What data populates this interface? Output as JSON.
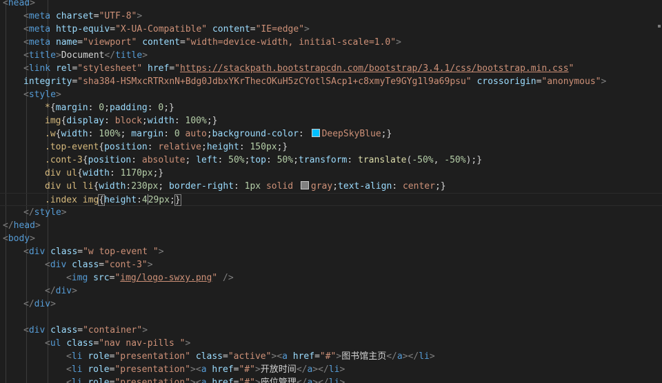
{
  "code": {
    "l1": [
      "<",
      "head",
      ">"
    ],
    "l2": [
      "<",
      "meta",
      "charset",
      "=",
      "\"UTF-8\"",
      ">"
    ],
    "l3": [
      "<",
      "meta",
      "http-equiv",
      "=",
      "\"X-UA-Compatible\"",
      "content",
      "=",
      "\"IE=edge\"",
      ">"
    ],
    "l4": [
      "<",
      "meta",
      "name",
      "=",
      "\"viewport\"",
      "content",
      "=",
      "\"width=device-width, initial-scale=1.0\"",
      ">"
    ],
    "l5": [
      "<",
      "title",
      ">",
      "Document",
      "</",
      "title",
      ">"
    ],
    "l6": [
      "<",
      "link",
      "rel",
      "=",
      "\"stylesheet\"",
      "href",
      "=",
      "\"",
      "https://stackpath.bootstrapcdn.com/bootstrap/3.4.1/css/bootstrap.min.css",
      "\""
    ],
    "l7": [
      "integrity",
      "=",
      "\"sha384-HSMxcRTRxnN+Bdg0JdbxYKrThecOKuH5zCYotlSAcp1+c8xmyTe9GYg1l9a69psu\"",
      "crossorigin",
      "=",
      "\"anonymous\"",
      ">"
    ],
    "l8": [
      "<",
      "style",
      ">"
    ],
    "l9": [
      "*",
      "{",
      "margin",
      ": ",
      "0",
      ";",
      "padding",
      ": ",
      "0",
      ";}"
    ],
    "l10": [
      "img",
      "{",
      "display",
      ": ",
      "block",
      ";",
      "width",
      ": ",
      "100%",
      ";}"
    ],
    "l11": [
      ".w",
      "{",
      "width",
      ": ",
      "100%",
      "; ",
      "margin",
      ": ",
      "0",
      " ",
      "auto",
      ";",
      "background-color",
      ": ",
      "DeepSkyBlue",
      ";}"
    ],
    "l12": [
      ".top-event",
      "{",
      "position",
      ": ",
      "relative",
      ";",
      "height",
      ": ",
      "150px",
      ";}"
    ],
    "l13": [
      ".cont-3",
      "{",
      "position",
      ": ",
      "absolute",
      "; ",
      "left",
      ": ",
      "50%",
      ";",
      "top",
      ": ",
      "50%",
      ";",
      "transform",
      ": ",
      "translate",
      "(",
      "-50%",
      ", ",
      "-50%",
      ");}"
    ],
    "l14": [
      "div ul",
      "{",
      "width",
      ": ",
      "1170px",
      ";}"
    ],
    "l15": [
      "div ul li",
      "{",
      "width",
      ":",
      "230px",
      "; ",
      "border-right",
      ": ",
      "1px",
      " ",
      "solid",
      " ",
      "gray",
      ";",
      "text-align",
      ": ",
      "center",
      ";}"
    ],
    "l16": [
      ".index img",
      "{",
      "height",
      ":",
      "4",
      "29px",
      ";",
      "}"
    ],
    "l17": [
      "</",
      "style",
      ">"
    ],
    "l18": [
      "</",
      "head",
      ">"
    ],
    "l19": [
      "<",
      "body",
      ">"
    ],
    "l20": [
      "<",
      "div",
      "class",
      "=",
      "\"w top-event \"",
      ">"
    ],
    "l21": [
      "<",
      "div",
      "class",
      "=",
      "\"cont-3\"",
      ">"
    ],
    "l22": [
      "<",
      "img",
      "src",
      "=",
      "\"",
      "img/logo-swxy.png",
      "\"",
      " />"
    ],
    "l23": [
      "</",
      "div",
      ">"
    ],
    "l24": [
      "</",
      "div",
      ">"
    ],
    "l26": [
      "<",
      "div",
      "class",
      "=",
      "\"container\"",
      ">"
    ],
    "l27": [
      "<",
      "ul",
      "class",
      "=",
      "\"nav nav-pills \"",
      ">"
    ],
    "l28": [
      "<",
      "li",
      "role",
      "=",
      "\"presentation\"",
      "class",
      "=",
      "\"active\"",
      "><",
      "a",
      "href",
      "=",
      "\"#\"",
      ">",
      "图书馆主页",
      "</",
      "a",
      "></",
      "li",
      ">"
    ],
    "l29": [
      "<",
      "li",
      "role",
      "=",
      "\"presentation\"",
      "><",
      "a",
      "href",
      "=",
      "\"#\"",
      ">",
      "开放时间",
      "</",
      "a",
      "></",
      "li",
      ">"
    ],
    "l30": [
      "<",
      "li",
      "role",
      "=",
      "\"presentation\"",
      "><",
      "a",
      "href",
      "=",
      "\"#\"",
      ">",
      "座位管理",
      "</",
      "a",
      "></",
      "li",
      ">"
    ]
  },
  "colors": {
    "background": "#1e1e1e",
    "tag": "#569cd6",
    "attribute": "#9cdcfe",
    "string": "#ce9178",
    "selector": "#d7ba7d",
    "number": "#b5cea8",
    "deepskyblue": "#00bfff",
    "gray": "#808080"
  }
}
